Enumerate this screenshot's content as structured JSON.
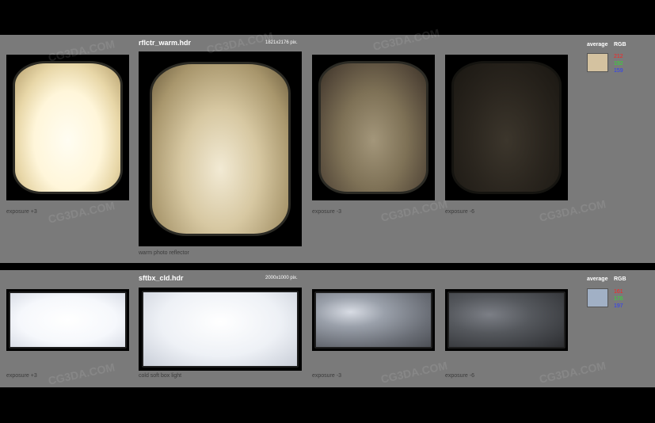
{
  "watermark": "CG3DA.COM",
  "rows": [
    {
      "title": "rflctr_warm.hdr",
      "dims": "1821x2176 pix.",
      "main_caption": "warm photo reflector",
      "labels": {
        "exp_plus3": "exposure +3",
        "exp_minus3": "exposure -3",
        "exp_minus6": "exposure -6"
      },
      "avg": {
        "label": "average",
        "rgb_label": "RGB",
        "color": "#d4c2a0",
        "r": "212",
        "g": "192",
        "b": "159"
      }
    },
    {
      "title": "sftbx_cld.hdr",
      "dims": "2000x1000 pix.",
      "main_caption": "cold soft box light",
      "labels": {
        "exp_plus3": "exposure +3",
        "exp_minus3": "exposure -3",
        "exp_minus6": "exposure -6"
      },
      "avg": {
        "label": "average",
        "rgb_label": "RGB",
        "color": "#a1b0c5",
        "r": "161",
        "g": "176",
        "b": "197"
      }
    }
  ],
  "colors": {
    "red": "#ff2020",
    "green": "#30e030",
    "blue": "#2a3aff"
  }
}
